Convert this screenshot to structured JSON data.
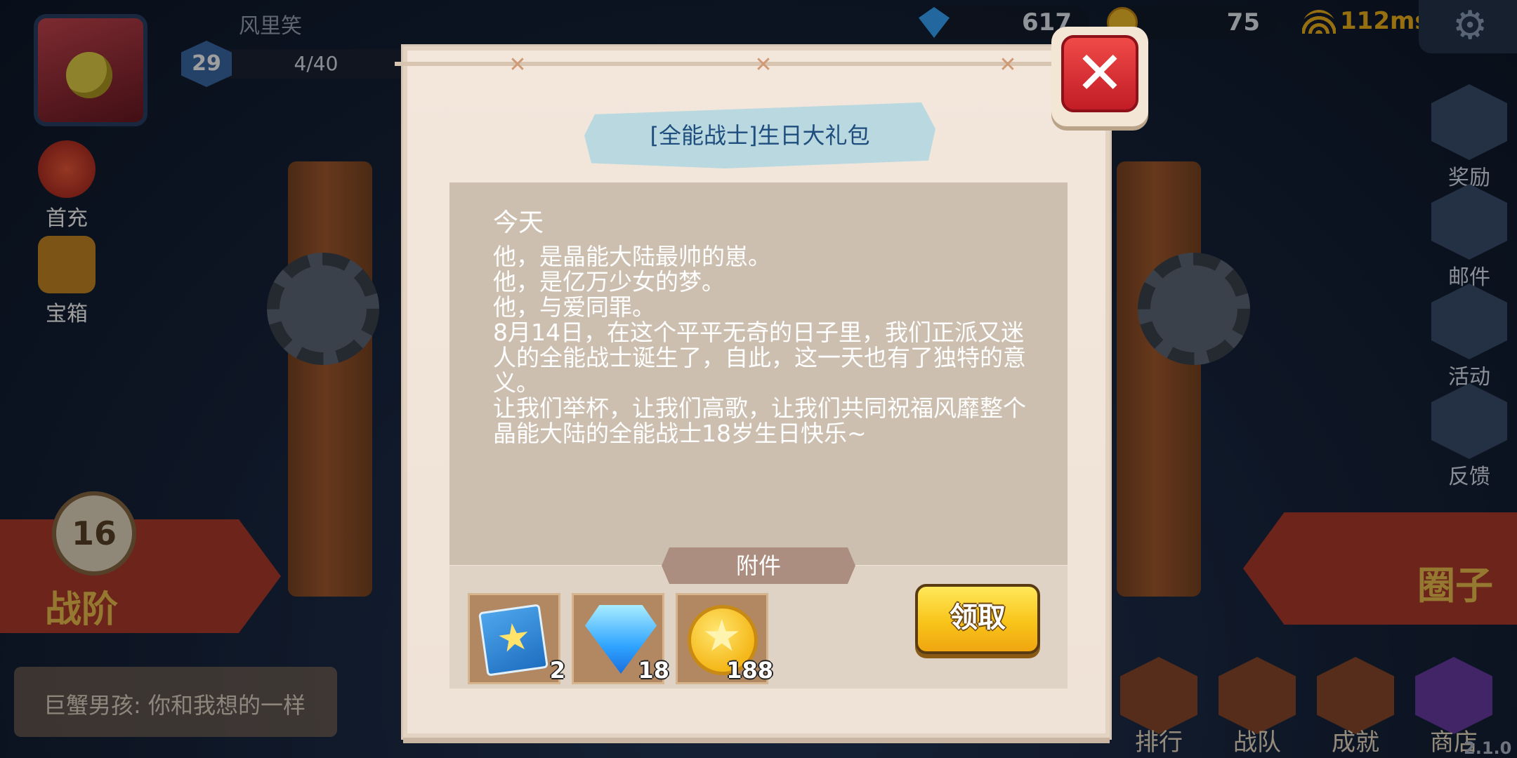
{
  "hud": {
    "player_name": "风里笑",
    "level": "29",
    "exp": "4/40",
    "gems": "617",
    "coins": "75",
    "ping": "112ms",
    "version": "2.1.0",
    "icons": {
      "gem": "gem-icon",
      "coin": "coin-icon",
      "wifi": "wifi-icon",
      "settings": "gear-icon"
    }
  },
  "left_menu": [
    {
      "label": "首充",
      "icon": "moneybag-icon"
    },
    {
      "label": "宝箱",
      "icon": "treasure-chest-icon"
    }
  ],
  "right_menu": [
    {
      "label": "奖励",
      "icon": "reward-icon"
    },
    {
      "label": "邮件",
      "icon": "mail-icon"
    },
    {
      "label": "活动",
      "icon": "flag-icon"
    },
    {
      "label": "反馈",
      "icon": "headset-icon"
    }
  ],
  "rank": {
    "number": "16",
    "label": "战阶"
  },
  "circle": {
    "label": "圈子"
  },
  "chat": {
    "preview": "巨蟹男孩: 你和我想的一样"
  },
  "bottom_tabs": [
    {
      "label": "排行",
      "icon": "podium-icon"
    },
    {
      "label": "战队",
      "icon": "team-icon"
    },
    {
      "label": "成就",
      "icon": "trophy-icon"
    },
    {
      "label": "商店",
      "icon": "cart-icon"
    }
  ],
  "dialog": {
    "title": "[全能战士]生日大礼包",
    "message_title": "今天",
    "message_body": "他，是晶能大陆最帅的崽。\n他，是亿万少女的梦。\n他，与爱同罪。\n8月14日，在这个平平无奇的日子里，我们正派又迷人的全能战士诞生了，自此，这一天也有了独特的意义。\n让我们举杯，让我们高歌，让我们共同祝福风靡整个晶能大陆的全能战士18岁生日快乐~",
    "attachments_label": "附件",
    "attachments": [
      {
        "icon": "star-scroll-icon",
        "count": "2"
      },
      {
        "icon": "diamond-icon",
        "count": "18"
      },
      {
        "icon": "gold-coin-icon",
        "count": "188"
      }
    ],
    "claim_label": "领取",
    "close_icon": "close-icon",
    "colors": {
      "title_ribbon": "#b9d8df",
      "claim_button": "#f8c41a",
      "close_button": "#e03236"
    }
  }
}
